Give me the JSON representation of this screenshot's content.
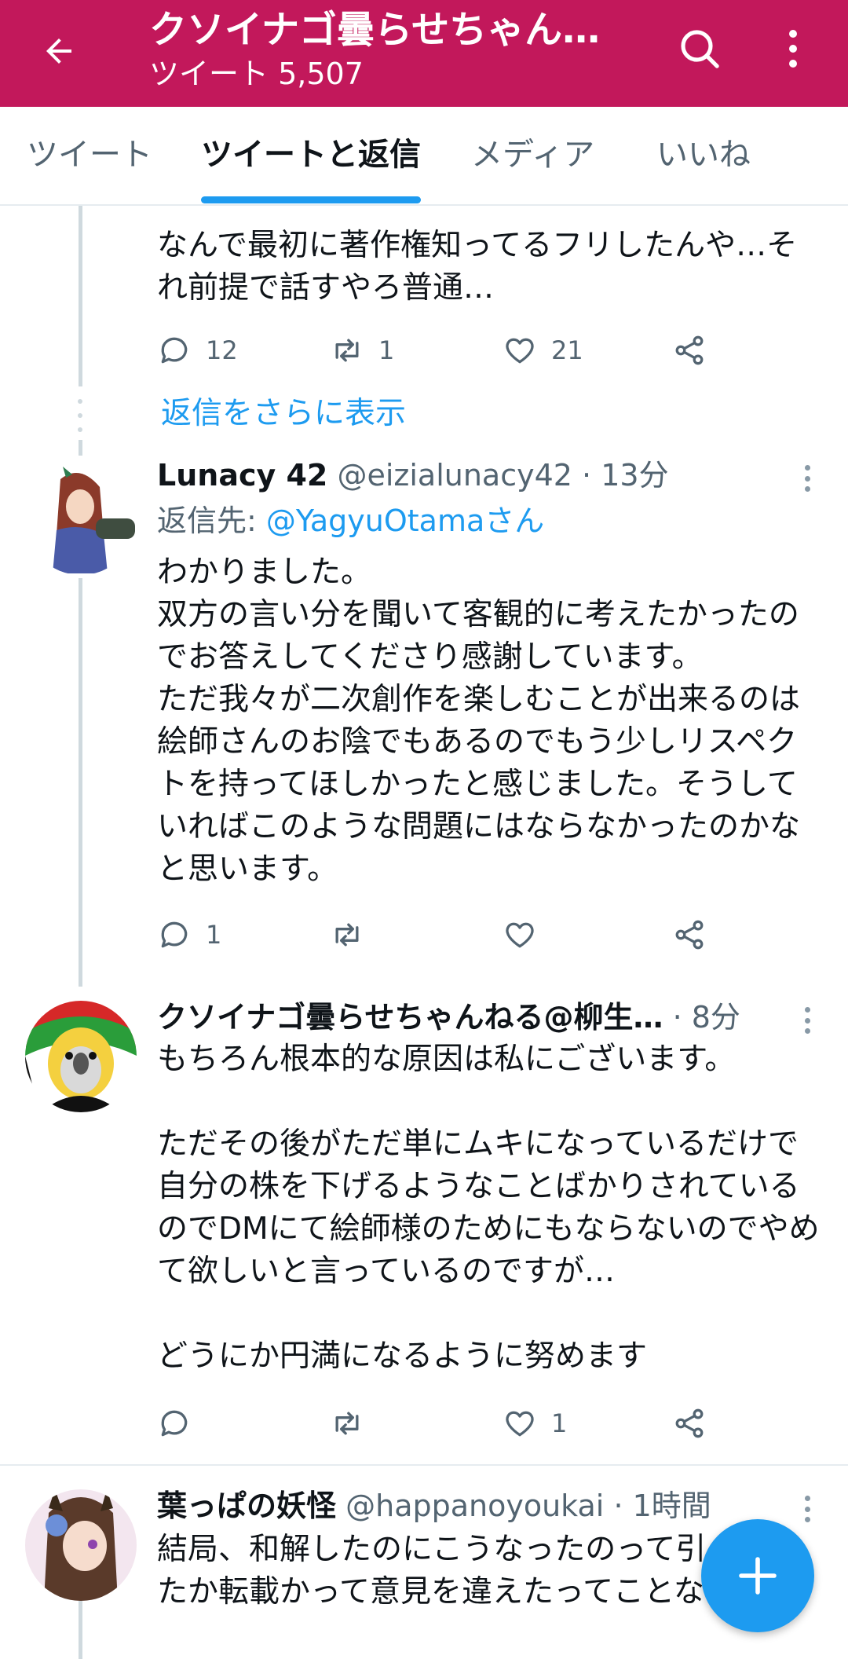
{
  "header": {
    "title": "クソイナゴ曇らせちゃんねる@柳生",
    "subtitle": "ツイート 5,507",
    "brand_color": "#c2185b",
    "icons": [
      "back-arrow-icon",
      "search-icon",
      "more-vertical-icon"
    ]
  },
  "tabs": [
    {
      "label": "ツイート",
      "active": false
    },
    {
      "label": "ツイートと返信",
      "active": true
    },
    {
      "label": "メディア",
      "active": false
    },
    {
      "label": "いいね",
      "active": false
    }
  ],
  "accent_color": "#1d9bf0",
  "tweet0": {
    "text": "なんで最初に著作権知ってるフリしたんや…それ前提で話すやろ普通…",
    "replies": "12",
    "retweets": "1",
    "likes": "21"
  },
  "more_replies": "返信をさらに表示",
  "tweet1": {
    "name": "Lunacy 42",
    "handle": "@eizialunacy42",
    "time": "13分",
    "reply_prefix": "返信先: ",
    "reply_mention": "@YagyuOtamaさん",
    "text": "わかりました。\n双方の言い分を聞いて客観的に考えたかったのでお答えしてくださり感謝しています。\nただ我々が二次創作を楽しむことが出来るのは絵師さんのお陰でもあるのでもう少しリスペクトを持ってほしかったと感じました。そうしていればこのような問題にはならなかったのかなと思います。",
    "replies": "1",
    "retweets": "",
    "likes": ""
  },
  "tweet2": {
    "name": "クソイナゴ曇らせちゃんねる@柳生…",
    "handle": "",
    "time": "8分",
    "text": "もちろん根本的な原因は私にございます。\n\nただその後がただ単にムキになっているだけで自分の株を下げるようなことばかりされているのでDMにて絵師様のためにもならないのでやめて欲しいと言っているのですが…\n\nどうにか円満になるように努めます",
    "replies": "",
    "retweets": "",
    "likes": "1"
  },
  "tweet3": {
    "name": "葉っぱの妖怪",
    "handle": "@happanoyoukai",
    "time": "1時間",
    "text": "結局、和解したのにこうなったのって引っ\nたか転載かって意見を違えたってことな"
  },
  "fab": {
    "icon": "plus-icon"
  }
}
